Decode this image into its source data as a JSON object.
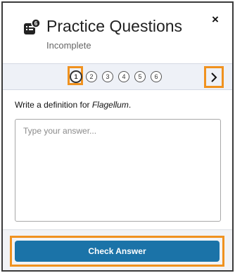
{
  "header": {
    "icon": "quiz-icon",
    "badge": "6",
    "title": "Practice Questions",
    "status": "Incomplete",
    "close_label": "×"
  },
  "question_nav": {
    "items": [
      "1",
      "2",
      "3",
      "4",
      "5",
      "6"
    ],
    "current": "1",
    "next_icon": "chevron-right-icon"
  },
  "question": {
    "prompt_prefix": "Write a definition for ",
    "term": "Flagellum",
    "prompt_suffix": "."
  },
  "answer": {
    "placeholder": "Type your answer...",
    "value": ""
  },
  "footer": {
    "check_label": "Check Answer"
  },
  "colors": {
    "accent": "#1b73a8",
    "highlight": "#f0921f",
    "nav_bg": "#eef1f7"
  }
}
